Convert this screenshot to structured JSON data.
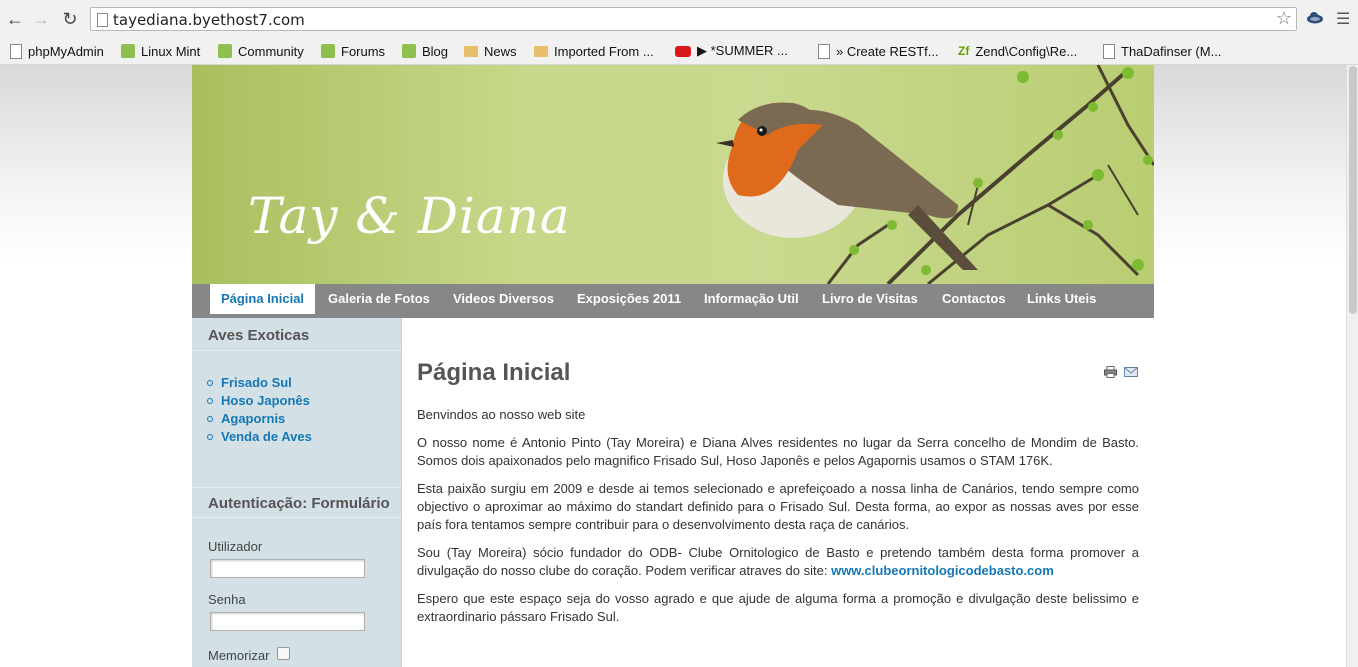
{
  "browser": {
    "url": "tayediana.byethost7.com",
    "bookmarks": [
      {
        "label": "phpMyAdmin",
        "icon": "page-icon"
      },
      {
        "label": "Linux Mint",
        "icon": "mint-icon"
      },
      {
        "label": "Community",
        "icon": "mint-icon"
      },
      {
        "label": "Forums",
        "icon": "mint-icon"
      },
      {
        "label": "Blog",
        "icon": "mint-icon"
      },
      {
        "label": "News",
        "icon": "folder-icon"
      },
      {
        "label": "Imported From ...",
        "icon": "folder-icon"
      },
      {
        "label": "▶ *SUMMER ...",
        "icon": "youtube-icon"
      },
      {
        "label": "» Create RESTf...",
        "icon": "page-icon"
      },
      {
        "label": "Zend\\Config\\Re...",
        "icon": "zend-icon"
      },
      {
        "label": "ThaDafinser (M...",
        "icon": "page-icon"
      }
    ],
    "overflow": "»"
  },
  "header": {
    "site_title": "Tay & Diana"
  },
  "main_nav": [
    {
      "label": "Página Inicial",
      "active": true
    },
    {
      "label": "Galeria de Fotos"
    },
    {
      "label": "Videos Diversos"
    },
    {
      "label": "Exposições 2011"
    },
    {
      "label": "Informação Util"
    },
    {
      "label": "Livro de Visitas"
    },
    {
      "label": "Contactos"
    },
    {
      "label": "Links Uteis"
    }
  ],
  "sidebar": {
    "aves_title": "Aves Exoticas",
    "aves_items": [
      "Frisado Sul",
      "Hoso Japonês",
      "Agapornis",
      "Venda de Aves"
    ],
    "login_title": "Autenticação: Formulário",
    "user_label": "Utilizador",
    "pass_label": "Senha",
    "remember_label": "Memorizar"
  },
  "content": {
    "title": "Página Inicial",
    "p1": "Benvindos ao nosso web site",
    "p2": "O nosso nome é Antonio Pinto (Tay Moreira) e Diana Alves residentes no lugar da Serra concelho de Mondim de Basto. Somos dois apaixonados pelo magnifico Frisado Sul, Hoso Japonês e pelos Agapornis usamos o STAM 176K.",
    "p3": "Esta paixão surgiu em 2009 e desde ai temos selecionado e aprefeiçoado a nossa linha de Canários, tendo sempre como objectivo o aproximar ao máximo do standart definido para o Frisado Sul. Desta forma, ao expor as nossas aves por esse país fora tentamos sempre contribuir para o desenvolvimento desta raça de canários.",
    "p4_text": " Sou (Tay Moreira) sócio fundador do ODB- Clube Ornitologico de Basto e pretendo também desta forma promover a divulgação do nosso clube do coração. Podem verificar atraves do site: ",
    "p4_link": "www.clubeornitologicodebasto.com",
    "p5": "Espero que este espaço seja do vosso agrado e que ajude de alguma forma a promoção e divulgação deste belissimo e extraordinario pássaro Frisado Sul."
  }
}
